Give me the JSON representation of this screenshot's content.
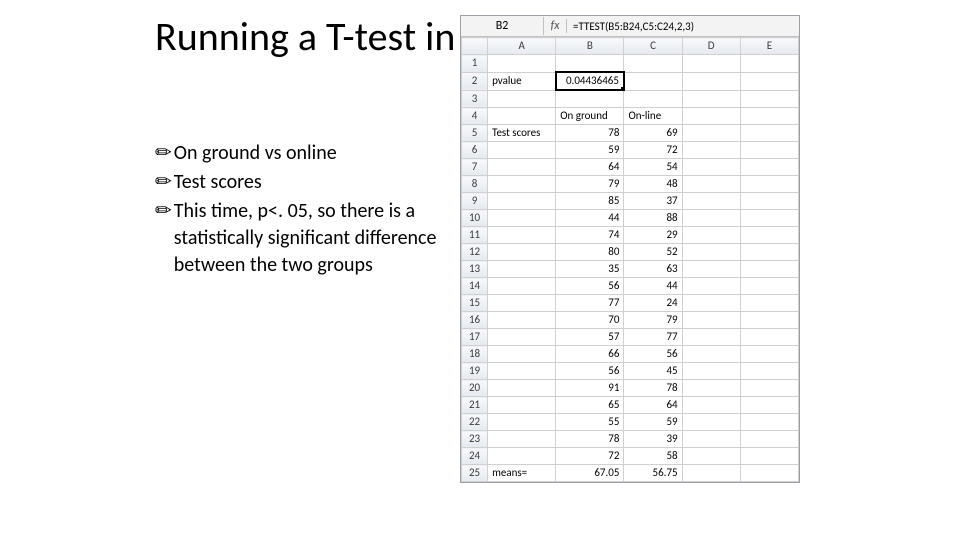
{
  "title": "Running a T-test in Excel",
  "bullets": {
    "glyph": "✏",
    "items": [
      "On ground vs online",
      "Test scores",
      "This time, p<. 05, so there is a statistically significant difference between the two groups"
    ]
  },
  "excel": {
    "namebox": "B2",
    "fx_label": "fx",
    "formula": "=TTEST(B5:B24,C5:C24,2,3)",
    "columns": [
      "A",
      "B",
      "C",
      "D",
      "E"
    ],
    "row_count": 25,
    "active": {
      "row": 2,
      "col": "B"
    },
    "cells": {
      "A2": "pvalue",
      "B2": "0.04436465",
      "B4": "On ground",
      "C4": "On-line",
      "A5": "Test scores",
      "B5": "78",
      "C5": "69",
      "B6": "59",
      "C6": "72",
      "B7": "64",
      "C7": "54",
      "B8": "79",
      "C8": "48",
      "B9": "85",
      "C9": "37",
      "B10": "44",
      "C10": "88",
      "B11": "74",
      "C11": "29",
      "B12": "80",
      "C12": "52",
      "B13": "35",
      "C13": "63",
      "B14": "56",
      "C14": "44",
      "B15": "77",
      "C15": "24",
      "B16": "70",
      "C16": "79",
      "B17": "57",
      "C17": "77",
      "B18": "66",
      "C18": "56",
      "B19": "56",
      "C19": "45",
      "B20": "91",
      "C20": "78",
      "B21": "65",
      "C21": "64",
      "B22": "55",
      "C22": "59",
      "B23": "78",
      "C23": "39",
      "B24": "72",
      "C24": "58",
      "A25": "means=",
      "B25": "67.05",
      "C25": "56.75"
    },
    "text_aligned_left": [
      "A2",
      "A5",
      "A25",
      "B4",
      "C4"
    ]
  }
}
